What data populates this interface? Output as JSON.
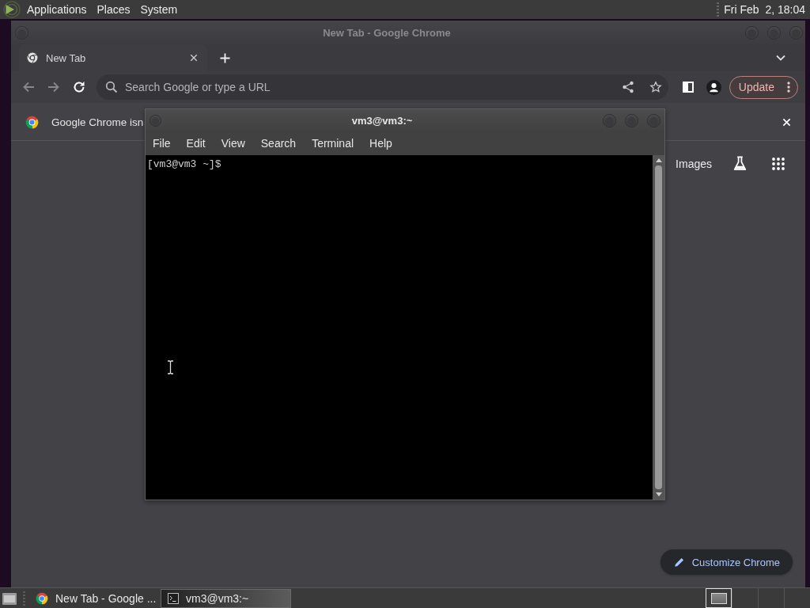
{
  "top_panel": {
    "menus": [
      "Applications",
      "Places",
      "System"
    ],
    "clock": "Fri Feb  2, 18:04"
  },
  "chrome_window": {
    "title": "New Tab - Google Chrome",
    "tabs": [
      {
        "label": "New Tab",
        "selected": true
      }
    ],
    "omnibox": {
      "placeholder": "Search Google or type a URL"
    },
    "update_button": "Update",
    "infobar": {
      "text": "Google Chrome isn"
    },
    "links": [
      "Images"
    ],
    "customize_button": "Customize Chrome"
  },
  "terminal_window": {
    "title": "vm3@vm3:~",
    "menus": [
      "File",
      "Edit",
      "View",
      "Search",
      "Terminal",
      "Help"
    ],
    "lines": [
      "[vm3@vm3 ~]$"
    ]
  },
  "taskbar": {
    "tasks": [
      {
        "label": "New Tab - Google ...",
        "kind": "browser",
        "selected": false
      },
      {
        "label": "vm3@vm3:~",
        "kind": "terminal",
        "selected": true
      }
    ],
    "workspaces": [
      {
        "selected": true,
        "has_windows": true
      },
      {
        "selected": false,
        "has_windows": false
      },
      {
        "selected": false,
        "has_windows": false
      },
      {
        "selected": false,
        "has_windows": false
      }
    ]
  }
}
